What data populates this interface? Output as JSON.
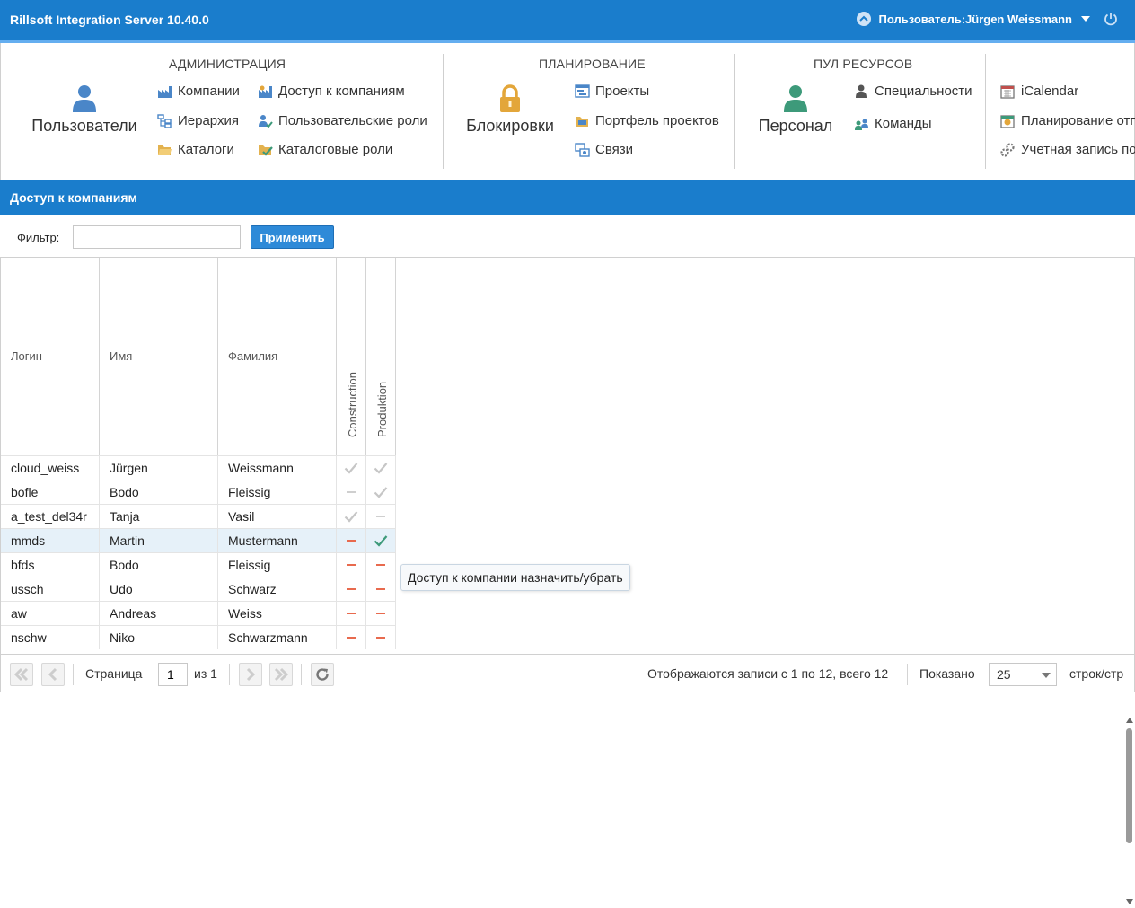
{
  "app": {
    "title": "Rillsoft Integration Server 10.40.0",
    "user_label": "Пользователь:Jürgen Weissmann"
  },
  "ribbon": {
    "admin": {
      "title": "АДМИНИСТРАЦИЯ",
      "big": "Пользователи",
      "items": [
        "Компании",
        "Доступ к компаниям",
        "Иерархия",
        "Пользовательские роли",
        "Каталоги",
        "Каталоговые роли"
      ]
    },
    "planning": {
      "title": "ПЛАНИРОВАНИЕ",
      "big": "Блокировки",
      "items": [
        "Проекты",
        "Портфель проектов",
        "Связи"
      ]
    },
    "resources": {
      "title": "ПУЛ РЕСУРСОВ",
      "big": "Персонал",
      "items": [
        "Специальности",
        "Команды"
      ]
    },
    "other": {
      "items": [
        "iCalendar",
        "Планирование отп",
        "Учетная запись по"
      ]
    }
  },
  "section": {
    "title": "Доступ к компаниям"
  },
  "filter": {
    "label": "Фильтр:",
    "value": "",
    "apply": "Применить"
  },
  "grid": {
    "columns": {
      "login": "Логин",
      "first": "Имя",
      "last": "Фамилия",
      "c1": "Construction",
      "c2": "Produktion"
    },
    "rows": [
      {
        "login": "cloud_weiss",
        "first": "Jürgen",
        "last": "Weissmann",
        "c1": "check-gray",
        "c2": "check-gray"
      },
      {
        "login": "bofle",
        "first": "Bodo",
        "last": "Fleissig",
        "c1": "dash-gray",
        "c2": "check-gray"
      },
      {
        "login": "a_test_del34r",
        "first": "Tanja",
        "last": "Vasil",
        "c1": "check-gray",
        "c2": "dash-gray"
      },
      {
        "login": "mmds",
        "first": "Martin",
        "last": "Mustermann",
        "c1": "dash-red",
        "c2": "check-green"
      },
      {
        "login": "bfds",
        "first": "Bodo",
        "last": "Fleissig",
        "c1": "dash-red",
        "c2": "dash-red"
      },
      {
        "login": "ussch",
        "first": "Udo",
        "last": "Schwarz",
        "c1": "dash-red",
        "c2": "dash-red"
      },
      {
        "login": "aw",
        "first": "Andreas",
        "last": "Weiss",
        "c1": "dash-red",
        "c2": "dash-red"
      },
      {
        "login": "nschw",
        "first": "Niko",
        "last": "Schwarzmann",
        "c1": "dash-red",
        "c2": "dash-red"
      }
    ],
    "tooltip": "Доступ к компании назначить/убрать"
  },
  "pager": {
    "page_label": "Страница",
    "page_value": "1",
    "of_label": "из 1",
    "records": "Отображаются записи с 1 по 12, всего 12",
    "shown_label": "Показано",
    "page_size": "25",
    "per_page": "строк/стр"
  },
  "colors": {
    "brand": "#1a7dcc",
    "accent": "#2e8ad8",
    "check_green": "#3d9a7a",
    "dash_red": "#e86a4e"
  }
}
